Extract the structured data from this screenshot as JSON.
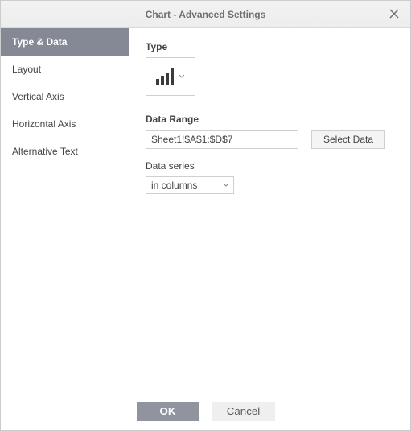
{
  "dialog": {
    "title": "Chart - Advanced Settings"
  },
  "sidebar": {
    "items": [
      {
        "label": "Type & Data",
        "active": true
      },
      {
        "label": "Layout",
        "active": false
      },
      {
        "label": "Vertical Axis",
        "active": false
      },
      {
        "label": "Horizontal Axis",
        "active": false
      },
      {
        "label": "Alternative Text",
        "active": false
      }
    ]
  },
  "content": {
    "type_label": "Type",
    "chart_type": "bar-chart",
    "data_range_label": "Data Range",
    "data_range_value": "Sheet1!$A$1:$D$7",
    "select_data_button": "Select Data",
    "data_series_label": "Data series",
    "data_series_value": "in columns"
  },
  "footer": {
    "ok": "OK",
    "cancel": "Cancel"
  }
}
